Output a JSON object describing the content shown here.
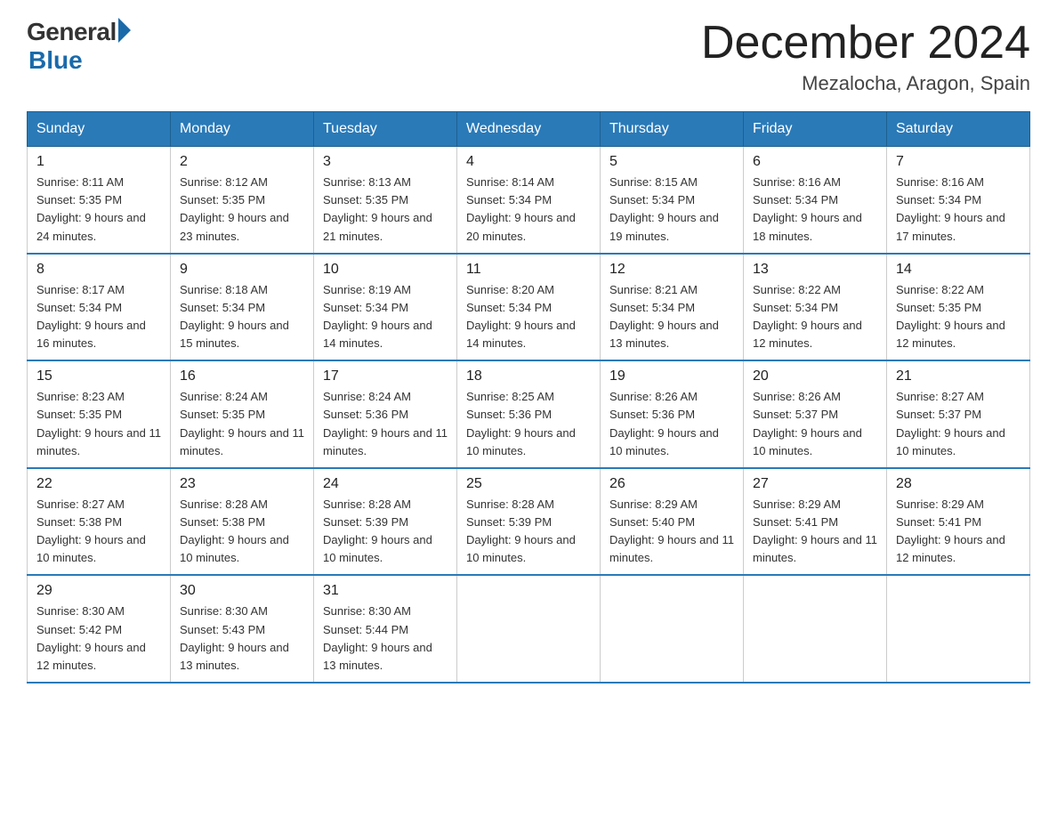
{
  "header": {
    "logo_general": "General",
    "logo_blue": "Blue",
    "month_title": "December 2024",
    "location": "Mezalocha, Aragon, Spain"
  },
  "days_of_week": [
    "Sunday",
    "Monday",
    "Tuesday",
    "Wednesday",
    "Thursday",
    "Friday",
    "Saturday"
  ],
  "weeks": [
    [
      {
        "day": "1",
        "sunrise": "8:11 AM",
        "sunset": "5:35 PM",
        "daylight": "9 hours and 24 minutes."
      },
      {
        "day": "2",
        "sunrise": "8:12 AM",
        "sunset": "5:35 PM",
        "daylight": "9 hours and 23 minutes."
      },
      {
        "day": "3",
        "sunrise": "8:13 AM",
        "sunset": "5:35 PM",
        "daylight": "9 hours and 21 minutes."
      },
      {
        "day": "4",
        "sunrise": "8:14 AM",
        "sunset": "5:34 PM",
        "daylight": "9 hours and 20 minutes."
      },
      {
        "day": "5",
        "sunrise": "8:15 AM",
        "sunset": "5:34 PM",
        "daylight": "9 hours and 19 minutes."
      },
      {
        "day": "6",
        "sunrise": "8:16 AM",
        "sunset": "5:34 PM",
        "daylight": "9 hours and 18 minutes."
      },
      {
        "day": "7",
        "sunrise": "8:16 AM",
        "sunset": "5:34 PM",
        "daylight": "9 hours and 17 minutes."
      }
    ],
    [
      {
        "day": "8",
        "sunrise": "8:17 AM",
        "sunset": "5:34 PM",
        "daylight": "9 hours and 16 minutes."
      },
      {
        "day": "9",
        "sunrise": "8:18 AM",
        "sunset": "5:34 PM",
        "daylight": "9 hours and 15 minutes."
      },
      {
        "day": "10",
        "sunrise": "8:19 AM",
        "sunset": "5:34 PM",
        "daylight": "9 hours and 14 minutes."
      },
      {
        "day": "11",
        "sunrise": "8:20 AM",
        "sunset": "5:34 PM",
        "daylight": "9 hours and 14 minutes."
      },
      {
        "day": "12",
        "sunrise": "8:21 AM",
        "sunset": "5:34 PM",
        "daylight": "9 hours and 13 minutes."
      },
      {
        "day": "13",
        "sunrise": "8:22 AM",
        "sunset": "5:34 PM",
        "daylight": "9 hours and 12 minutes."
      },
      {
        "day": "14",
        "sunrise": "8:22 AM",
        "sunset": "5:35 PM",
        "daylight": "9 hours and 12 minutes."
      }
    ],
    [
      {
        "day": "15",
        "sunrise": "8:23 AM",
        "sunset": "5:35 PM",
        "daylight": "9 hours and 11 minutes."
      },
      {
        "day": "16",
        "sunrise": "8:24 AM",
        "sunset": "5:35 PM",
        "daylight": "9 hours and 11 minutes."
      },
      {
        "day": "17",
        "sunrise": "8:24 AM",
        "sunset": "5:36 PM",
        "daylight": "9 hours and 11 minutes."
      },
      {
        "day": "18",
        "sunrise": "8:25 AM",
        "sunset": "5:36 PM",
        "daylight": "9 hours and 10 minutes."
      },
      {
        "day": "19",
        "sunrise": "8:26 AM",
        "sunset": "5:36 PM",
        "daylight": "9 hours and 10 minutes."
      },
      {
        "day": "20",
        "sunrise": "8:26 AM",
        "sunset": "5:37 PM",
        "daylight": "9 hours and 10 minutes."
      },
      {
        "day": "21",
        "sunrise": "8:27 AM",
        "sunset": "5:37 PM",
        "daylight": "9 hours and 10 minutes."
      }
    ],
    [
      {
        "day": "22",
        "sunrise": "8:27 AM",
        "sunset": "5:38 PM",
        "daylight": "9 hours and 10 minutes."
      },
      {
        "day": "23",
        "sunrise": "8:28 AM",
        "sunset": "5:38 PM",
        "daylight": "9 hours and 10 minutes."
      },
      {
        "day": "24",
        "sunrise": "8:28 AM",
        "sunset": "5:39 PM",
        "daylight": "9 hours and 10 minutes."
      },
      {
        "day": "25",
        "sunrise": "8:28 AM",
        "sunset": "5:39 PM",
        "daylight": "9 hours and 10 minutes."
      },
      {
        "day": "26",
        "sunrise": "8:29 AM",
        "sunset": "5:40 PM",
        "daylight": "9 hours and 11 minutes."
      },
      {
        "day": "27",
        "sunrise": "8:29 AM",
        "sunset": "5:41 PM",
        "daylight": "9 hours and 11 minutes."
      },
      {
        "day": "28",
        "sunrise": "8:29 AM",
        "sunset": "5:41 PM",
        "daylight": "9 hours and 12 minutes."
      }
    ],
    [
      {
        "day": "29",
        "sunrise": "8:30 AM",
        "sunset": "5:42 PM",
        "daylight": "9 hours and 12 minutes."
      },
      {
        "day": "30",
        "sunrise": "8:30 AM",
        "sunset": "5:43 PM",
        "daylight": "9 hours and 13 minutes."
      },
      {
        "day": "31",
        "sunrise": "8:30 AM",
        "sunset": "5:44 PM",
        "daylight": "9 hours and 13 minutes."
      },
      null,
      null,
      null,
      null
    ]
  ]
}
